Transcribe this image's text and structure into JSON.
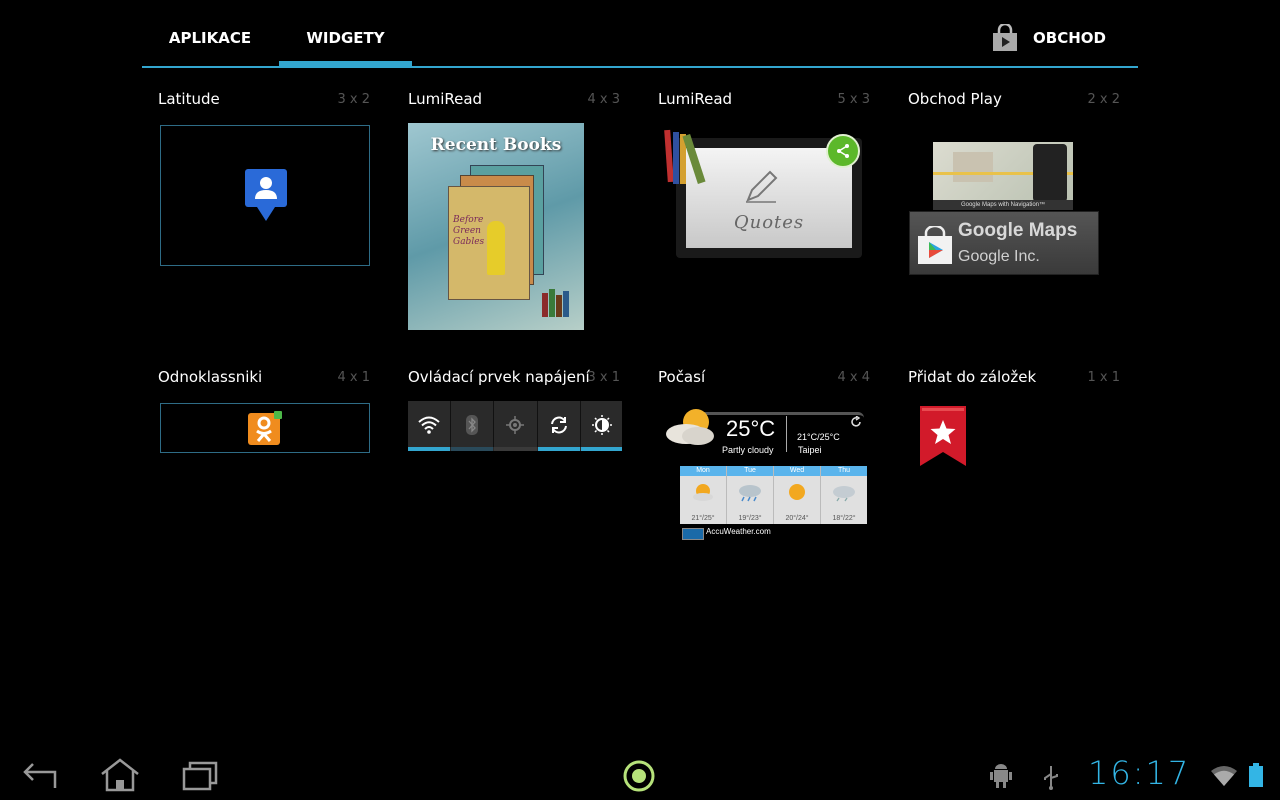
{
  "tabs": {
    "apps": "APLIKACE",
    "widgets": "WIDGETY"
  },
  "store_label": "OBCHOD",
  "widgets": [
    {
      "name": "Latitude",
      "size": "3 x 2"
    },
    {
      "name": "LumiRead",
      "size": "4 x 3"
    },
    {
      "name": "LumiRead",
      "size": "5 x 3"
    },
    {
      "name": "Obchod Play",
      "size": "2 x 2"
    },
    {
      "name": "Odnoklassniki",
      "size": "4 x 1"
    },
    {
      "name": "Ovládací prvek napájení",
      "size": "3 x 1"
    },
    {
      "name": "Počasí",
      "size": "4 x 4"
    },
    {
      "name": "Přidat do záložek",
      "size": "1 x 1"
    }
  ],
  "previews": {
    "recent_books": "Recent Books",
    "book_title": "Before Green Gables",
    "quotes": "Quotes",
    "maps_title": "Google Maps",
    "maps_dev": "Google Inc.",
    "maps_caption": "Google Maps with Navigation™",
    "weather": {
      "temp": "25°C",
      "cond": "Partly cloudy",
      "range": "21°C/25°C",
      "city": "Taipei",
      "days": [
        {
          "day": "Mon",
          "range": "21°/25°"
        },
        {
          "day": "Tue",
          "range": "19°/23°"
        },
        {
          "day": "Wed",
          "range": "20°/24°"
        },
        {
          "day": "Thu",
          "range": "18°/22°"
        }
      ],
      "brand": "AccuWeather.com"
    }
  },
  "status": {
    "time": "16:17"
  },
  "colors": {
    "accent": "#33a6cf",
    "clock": "#33b5e5"
  }
}
